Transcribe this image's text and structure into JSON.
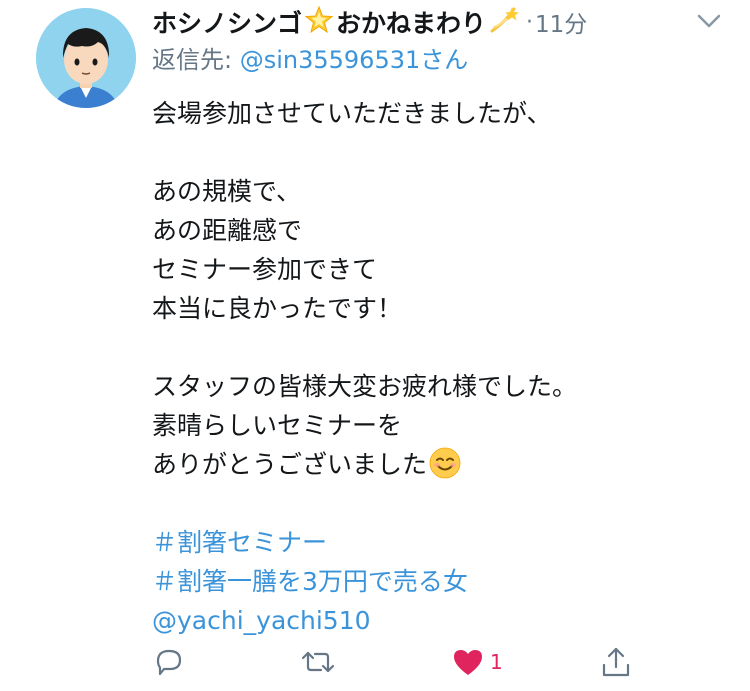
{
  "tweet": {
    "display_name": "ホシノシンゴ",
    "display_name_suffix": "おかねまわり",
    "separator": "·",
    "time": "11分",
    "reply_prefix": "返信先: ",
    "reply_to": "@sin35596531さん",
    "body_lines": [
      "会場参加させていただきましたが、",
      "",
      "あの規模で、",
      "あの距離感で",
      "セミナー参加できて",
      "本当に良かったです！",
      "",
      "スタッフの皆様大変お疲れ様でした。",
      "素晴らしいセミナーを",
      "ありがとうございました",
      ""
    ],
    "hashtags": [
      "＃割箸セミナー",
      "＃割箸一膳を3万円で売る女"
    ],
    "mention": "@yachi_yachi510",
    "like_count": "1"
  },
  "icons": {
    "name_emoji_1": "glowing-star-icon",
    "name_emoji_2": "dizzy-icon",
    "body_emoji": "smiling-face-icon",
    "caret": "chevron-down-icon",
    "reply": "reply-icon",
    "retweet": "retweet-icon",
    "like": "heart-icon",
    "share": "share-icon"
  },
  "colors": {
    "link": "#3b94d9",
    "secondary": "#657786",
    "like": "#e0245e",
    "avatar_bg": "#8fd3ef"
  }
}
